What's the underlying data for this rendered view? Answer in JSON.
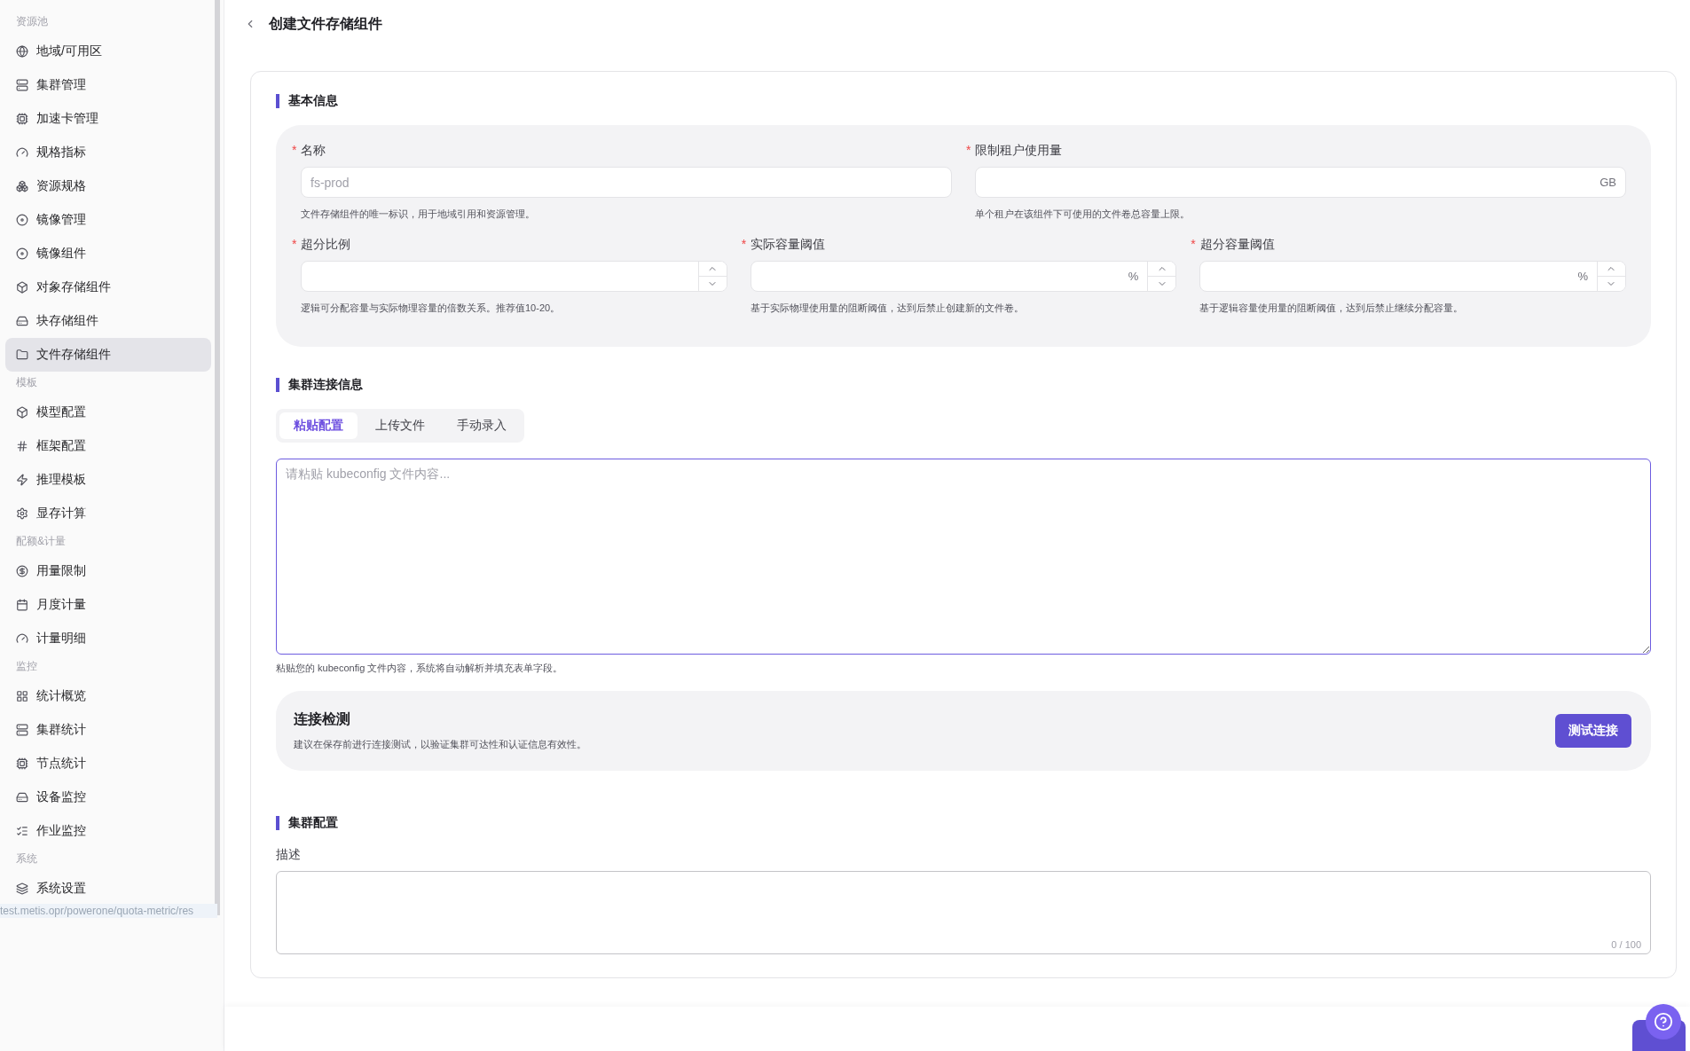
{
  "sidebar": {
    "groups": [
      {
        "title": "资源池",
        "items": [
          {
            "label": "地域/可用区",
            "selected": false
          },
          {
            "label": "集群管理",
            "selected": false
          },
          {
            "label": "加速卡管理",
            "selected": false
          },
          {
            "label": "规格指标",
            "selected": false
          },
          {
            "label": "资源规格",
            "selected": false
          },
          {
            "label": "镜像管理",
            "selected": false
          },
          {
            "label": "镜像组件",
            "selected": false
          },
          {
            "label": "对象存储组件",
            "selected": false
          },
          {
            "label": "块存储组件",
            "selected": false
          },
          {
            "label": "文件存储组件",
            "selected": true
          }
        ]
      },
      {
        "title": "模板",
        "items": [
          {
            "label": "模型配置",
            "selected": false
          },
          {
            "label": "框架配置",
            "selected": false
          },
          {
            "label": "推理模板",
            "selected": false
          },
          {
            "label": "显存计算",
            "selected": false
          }
        ]
      },
      {
        "title": "配额&计量",
        "items": [
          {
            "label": "用量限制",
            "selected": false
          },
          {
            "label": "月度计量",
            "selected": false
          },
          {
            "label": "计量明细",
            "selected": false
          }
        ]
      },
      {
        "title": "监控",
        "items": [
          {
            "label": "统计概览",
            "selected": false
          },
          {
            "label": "集群统计",
            "selected": false
          },
          {
            "label": "节点统计",
            "selected": false
          },
          {
            "label": "设备监控",
            "selected": false
          },
          {
            "label": "作业监控",
            "selected": false
          }
        ]
      },
      {
        "title": "系统",
        "items": [
          {
            "label": "系统设置",
            "selected": false
          }
        ]
      }
    ]
  },
  "status_url": "test.metis.opr/powerone/quota-metric/res",
  "page": {
    "title": "创建文件存储组件"
  },
  "basic": {
    "title": "基本信息",
    "rows": [
      [
        {
          "kind": "text",
          "mark": "*",
          "label": "名称",
          "placeholder": "fs-prod",
          "hint": "文件存储组件的唯一标识，用于地域引用和资源管理。"
        },
        {
          "kind": "unit",
          "mark": "*",
          "label": "限制租户使用量",
          "unit": "GB",
          "hint": "单个租户在该组件下可使用的文件卷总容量上限。"
        }
      ],
      [
        {
          "kind": "number",
          "mark": "*",
          "label": "超分比例",
          "hint": "逻辑可分配容量与实际物理容量的倍数关系。推荐值10-20。"
        },
        {
          "kind": "number",
          "mark": "*",
          "label": "实际容量阈值",
          "unit": "%",
          "hint": "基于实际物理使用量的阻断阈值，达到后禁止创建新的文件卷。"
        },
        {
          "kind": "number",
          "mark": "*",
          "label": "超分容量阈值",
          "unit": "%",
          "hint": "基于逻辑容量使用量的阻断阈值，达到后禁止继续分配容量。"
        }
      ]
    ]
  },
  "connection": {
    "title": "集群连接信息",
    "tabs": [
      {
        "label": "粘贴配置",
        "selected": true
      },
      {
        "label": "上传文件",
        "selected": false
      },
      {
        "label": "手动录入",
        "selected": false
      }
    ],
    "editor": {
      "placeholder": "请粘贴 kubeconfig 文件内容...",
      "focused": true
    },
    "hint": "粘贴您的 kubeconfig 文件内容，系统将自动解析并填充表单字段。",
    "check": {
      "title": "连接检测",
      "description": "建议在保存前进行连接测试，以验证集群可达性和认证信息有效性。",
      "button": "测试连接"
    }
  },
  "cluster": {
    "title": "集群配置",
    "label": "描述",
    "counter": "0 / 100"
  }
}
